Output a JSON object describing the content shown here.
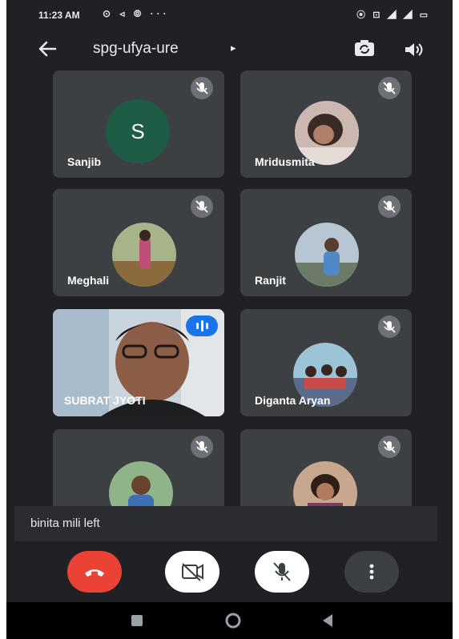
{
  "status_bar": {
    "time": "11:23 AM",
    "left_icons": "⊙ ◃ ⦾ ···",
    "right_icons": "⦿ ⊡ ◢ ◢ ▭"
  },
  "header": {
    "meeting_code": "spg-ufya-ure",
    "caret": "▸"
  },
  "participants": [
    {
      "name": "Sanjib",
      "initial": "S",
      "muted": true
    },
    {
      "name": "Mridusmita",
      "muted": true
    },
    {
      "name": "Meghali",
      "muted": true
    },
    {
      "name": "Ranjit",
      "muted": true
    },
    {
      "name": "SUBRAT JYOTI",
      "muted": false,
      "speaking": true,
      "video_on": true
    },
    {
      "name": "Diganta Aryan",
      "muted": true
    },
    {
      "name": "",
      "muted": true
    },
    {
      "name": "",
      "muted": true
    }
  ],
  "toast": {
    "message": "binita mili left"
  },
  "colors": {
    "background": "#202124",
    "tile": "#3c4043",
    "end_call": "#ea4335",
    "speaking_badge": "#1a73e8",
    "avatar_s": "#1e5c45"
  },
  "icons": [
    "back-arrow-icon",
    "caret-right-icon",
    "switch-camera-icon",
    "speaker-icon",
    "mic-off-icon",
    "speaking-indicator-icon",
    "end-call-icon",
    "camera-off-icon",
    "more-vert-icon",
    "nav-recents-icon",
    "nav-home-icon",
    "nav-back-icon"
  ]
}
